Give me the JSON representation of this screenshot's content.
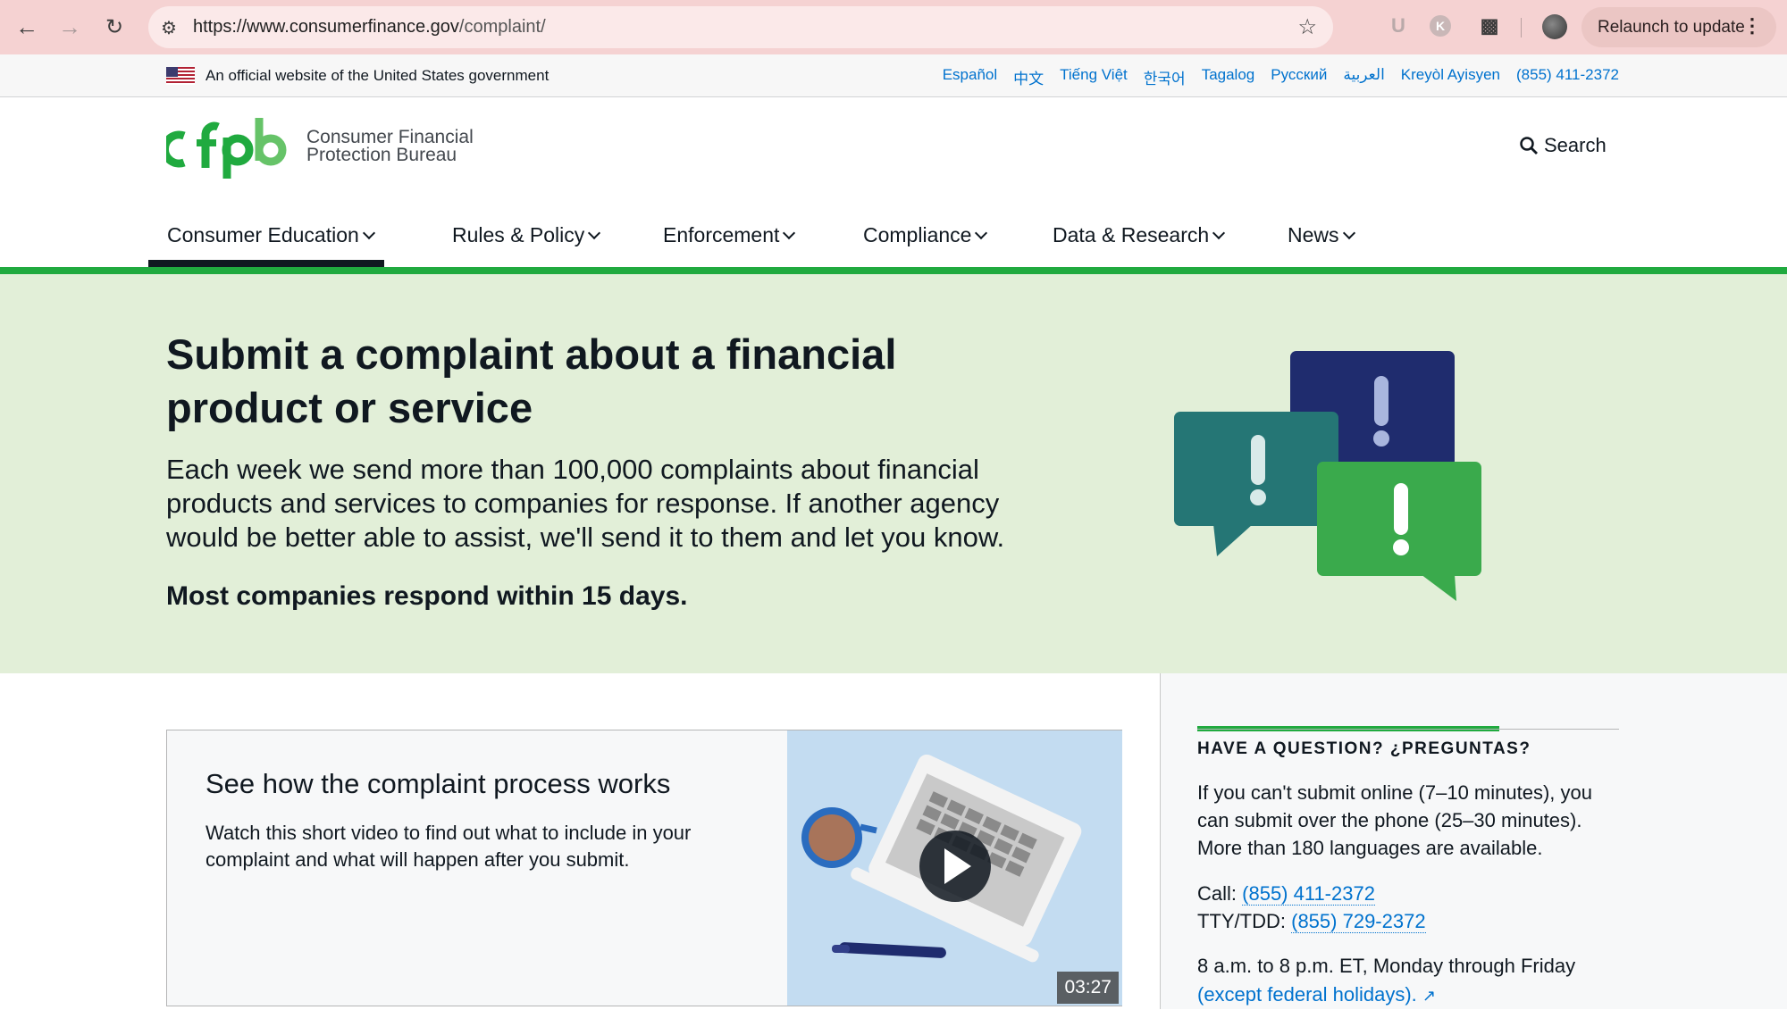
{
  "browser": {
    "url_host": "https://www.consumerfinance.gov",
    "url_path": "/complaint/",
    "relaunch_label": "Relaunch to update",
    "ext_u": "U",
    "ext_k": "K"
  },
  "gov_banner": {
    "text": "An official website of the United States government",
    "languages": [
      "Español",
      "中文",
      "Tiếng Việt",
      "한국어",
      "Tagalog",
      "Русский",
      "العربية",
      "Kreyòl Ayisyen",
      "(855) 411-2372"
    ]
  },
  "header": {
    "logo_line1": "Consumer Financial",
    "logo_line2": "Protection Bureau",
    "search_label": "Search"
  },
  "nav": {
    "items": [
      "Consumer Education",
      "Rules & Policy",
      "Enforcement",
      "Compliance",
      "Data & Research",
      "News"
    ]
  },
  "hero": {
    "title": "Submit a complaint about a financial product or service",
    "lead": "Each week we send more than 100,000 complaints about financial products and services to companies for response. If another agency would be better able to assist, we'll send it to them and let you know.",
    "emphasis": "Most companies respond within 15 days."
  },
  "video_card": {
    "title": "See how the complaint process works",
    "description": "Watch this short video to find out what to include in your complaint and what will happen after you submit.",
    "duration": "03:27"
  },
  "sidebar": {
    "heading": "HAVE A QUESTION? ¿PREGUNTAS?",
    "body": "If you can't submit online (7–10 minutes), you can submit over the phone (25–30 minutes). More than 180 languages are available.",
    "call_label": "Call:",
    "call_number": "(855) 411-2372",
    "tty_label": "TTY/TDD:",
    "tty_number": "(855) 729-2372",
    "hours": "8 a.m. to 8 p.m. ET, Monday through Friday",
    "holidays_link": "(except federal holidays)."
  },
  "colors": {
    "brand_green": "#20aa3f",
    "hero_bg": "#e2efd8",
    "link_blue": "#0072ce",
    "bubble_navy": "#1f2c6e",
    "bubble_teal": "#257675",
    "bubble_green": "#3aaa4c"
  }
}
